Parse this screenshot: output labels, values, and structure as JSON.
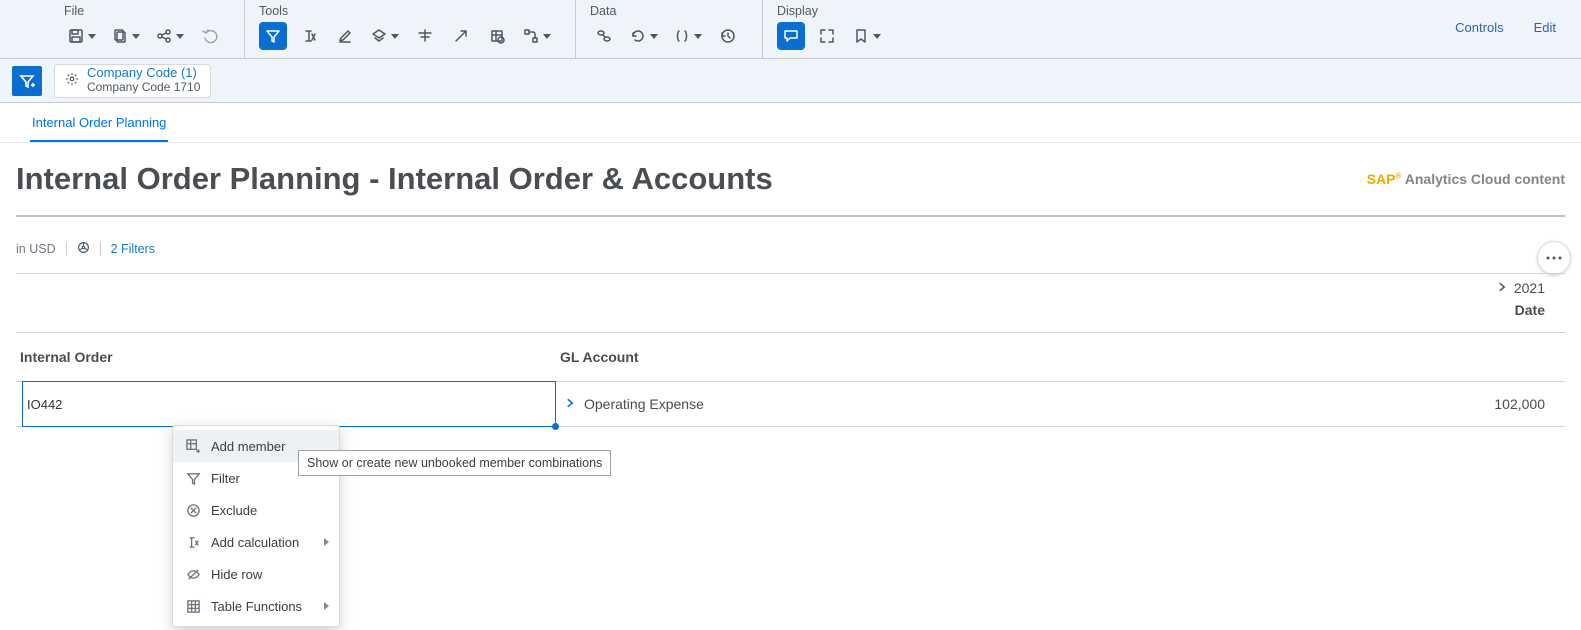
{
  "toolbar": {
    "groups": {
      "file": {
        "label": "File"
      },
      "tools": {
        "label": "Tools"
      },
      "data": {
        "label": "Data"
      },
      "display": {
        "label": "Display"
      }
    },
    "actions": {
      "controls": "Controls",
      "edit": "Edit"
    }
  },
  "filter": {
    "chip": {
      "title": "Company Code (1)",
      "subtitle": "Company Code 1710"
    }
  },
  "tabs": {
    "main": "Internal Order Planning"
  },
  "header": {
    "title": "Internal Order Planning - Internal Order & Accounts",
    "brand1": "SAP",
    "brand2": "Analytics Cloud content"
  },
  "meta": {
    "currency": "in USD",
    "filters": "2 Filters"
  },
  "columns": {
    "date": "Date",
    "year": "2021",
    "internal_order": "Internal Order",
    "gl_account": "GL Account"
  },
  "row": {
    "order": "IO442",
    "gl": "Operating Expense",
    "value": "102,000"
  },
  "ctx": {
    "add_member": "Add member",
    "filter": "Filter",
    "exclude": "Exclude",
    "add_calc": "Add calculation",
    "hide_row": "Hide row",
    "table_fn": "Table Functions"
  },
  "tooltip": "Show or create new unbooked member combinations"
}
